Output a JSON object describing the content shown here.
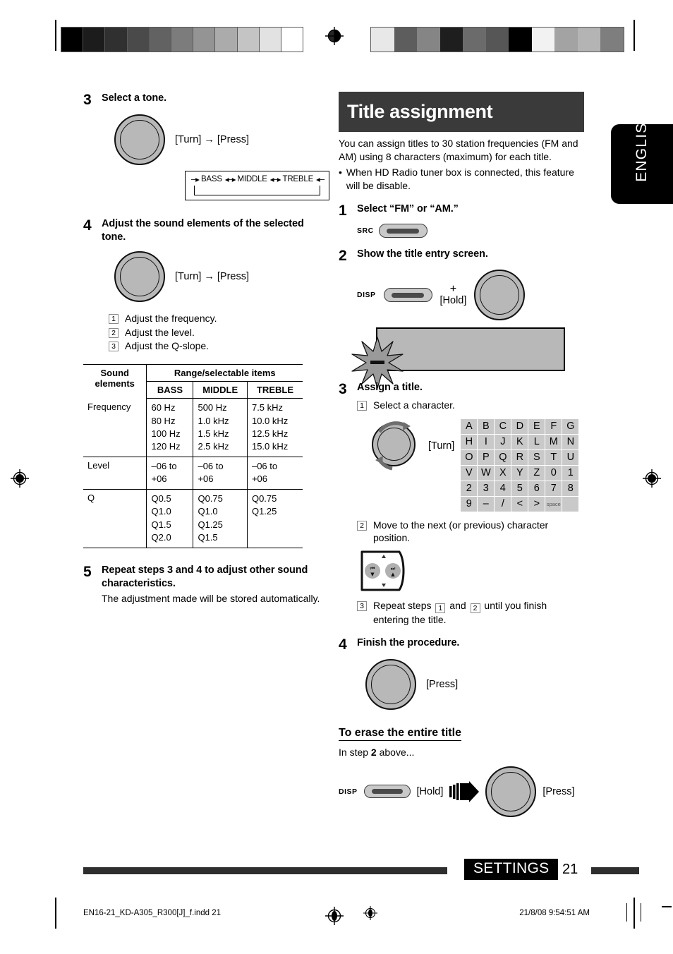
{
  "page": {
    "language_tab": "ENGLISH",
    "page_number": "21",
    "section_chip": "SETTINGS",
    "file_name": "EN16-21_KD-A305_R300[J]_f.indd   21",
    "timestamp": "21/8/08   9:54:51 AM"
  },
  "calibration": {
    "left_bar": [
      "#000000",
      "#1c1c1c",
      "#303030",
      "#4a4a4a",
      "#626262",
      "#7c7c7c",
      "#949494",
      "#ababab",
      "#c4c4c4",
      "#e2e2e2",
      "#ffffff"
    ],
    "right_bar": [
      "#e8e8e8",
      "#5d5d5d",
      "#858585",
      "#1e1e1e",
      "#6b6b6b",
      "#565656",
      "#000000",
      "#f2f2f2",
      "#a3a3a3",
      "#b4b4b4",
      "#7e7e7e"
    ]
  },
  "left_column": {
    "step3": {
      "number": "3",
      "title": "Select a tone.",
      "action_label": "[Turn]  →  [Press]",
      "flow": {
        "items": [
          "BASS",
          "MIDDLE",
          "TREBLE"
        ]
      }
    },
    "step4": {
      "number": "4",
      "title": "Adjust the sound elements of the selected tone.",
      "action_label": "[Turn]  →  [Press]",
      "substeps": [
        {
          "marker": "1",
          "text": "Adjust the frequency."
        },
        {
          "marker": "2",
          "text": "Adjust the level."
        },
        {
          "marker": "3",
          "text": "Adjust the Q-slope."
        }
      ]
    },
    "table": {
      "col1_header": "Sound elements",
      "group_header": "Range/selectable items",
      "columns": [
        "BASS",
        "MIDDLE",
        "TREBLE"
      ],
      "rows": [
        {
          "label": "Frequency",
          "cells": [
            [
              "60 Hz",
              "80 Hz",
              "100 Hz",
              "120 Hz"
            ],
            [
              "500 Hz",
              "1.0 kHz",
              "1.5 kHz",
              "2.5 kHz"
            ],
            [
              "7.5 kHz",
              "10.0 kHz",
              "12.5 kHz",
              "15.0 kHz"
            ]
          ]
        },
        {
          "label": "Level",
          "cells": [
            [
              "–06 to",
              "+06"
            ],
            [
              "–06 to",
              "+06"
            ],
            [
              "–06 to",
              "+06"
            ]
          ]
        },
        {
          "label": "Q",
          "cells": [
            [
              "Q0.5",
              "Q1.0",
              "Q1.5",
              "Q2.0"
            ],
            [
              "Q0.75",
              "Q1.0",
              "Q1.25",
              "Q1.5"
            ],
            [
              "Q0.75",
              "Q1.25"
            ]
          ]
        }
      ]
    },
    "step5": {
      "number": "5",
      "title": "Repeat steps 3 and 4 to adjust other sound characteristics.",
      "note": "The adjustment made will be stored automatically."
    }
  },
  "right_column": {
    "banner_title": "Title assignment",
    "intro": "You can assign titles to 30 station frequencies (FM and AM) using 8 characters (maximum) for each title.",
    "bullet": "When HD Radio tuner box is connected, this feature will be disable.",
    "step1": {
      "number": "1",
      "title": "Select “FM” or “AM.”",
      "button_caption": "SRC"
    },
    "step2": {
      "number": "2",
      "title": "Show the title entry screen.",
      "button_caption": "DISP",
      "plus": "+",
      "hold_label": "[Hold]"
    },
    "step3": {
      "number": "3",
      "title": "Assign a title.",
      "sub1_marker": "1",
      "sub1_text": "Select a character.",
      "turn_label": "[Turn]",
      "char_grid": {
        "rows": [
          [
            "A",
            "B",
            "C",
            "D",
            "E",
            "F",
            "G"
          ],
          [
            "H",
            "I",
            "J",
            "K",
            "L",
            "M",
            "N"
          ],
          [
            "O",
            "P",
            "Q",
            "R",
            "S",
            "T",
            "U"
          ],
          [
            "V",
            "W",
            "X",
            "Y",
            "Z",
            "0",
            "1"
          ],
          [
            "2",
            "3",
            "4",
            "5",
            "6",
            "7",
            "8"
          ],
          [
            "9",
            "–",
            "/",
            "<",
            ">",
            "space",
            ""
          ]
        ]
      },
      "sub2_marker": "2",
      "sub2_text": "Move to the next (or previous) character position.",
      "sub3_marker": "3",
      "sub3_text_a": "Repeat steps",
      "sub3_mark_a": "1",
      "sub3_text_b": "and",
      "sub3_mark_b": "2",
      "sub3_text_c": "until you finish entering the title."
    },
    "step4": {
      "number": "4",
      "title": "Finish the procedure.",
      "press_label": "[Press]"
    },
    "erase": {
      "heading": "To erase the entire title",
      "line_prefix": "In step ",
      "line_step": "2",
      "line_suffix": " above...",
      "disp_caption": "DISP",
      "hold_label": "[Hold]",
      "press_label": "[Press]"
    }
  }
}
